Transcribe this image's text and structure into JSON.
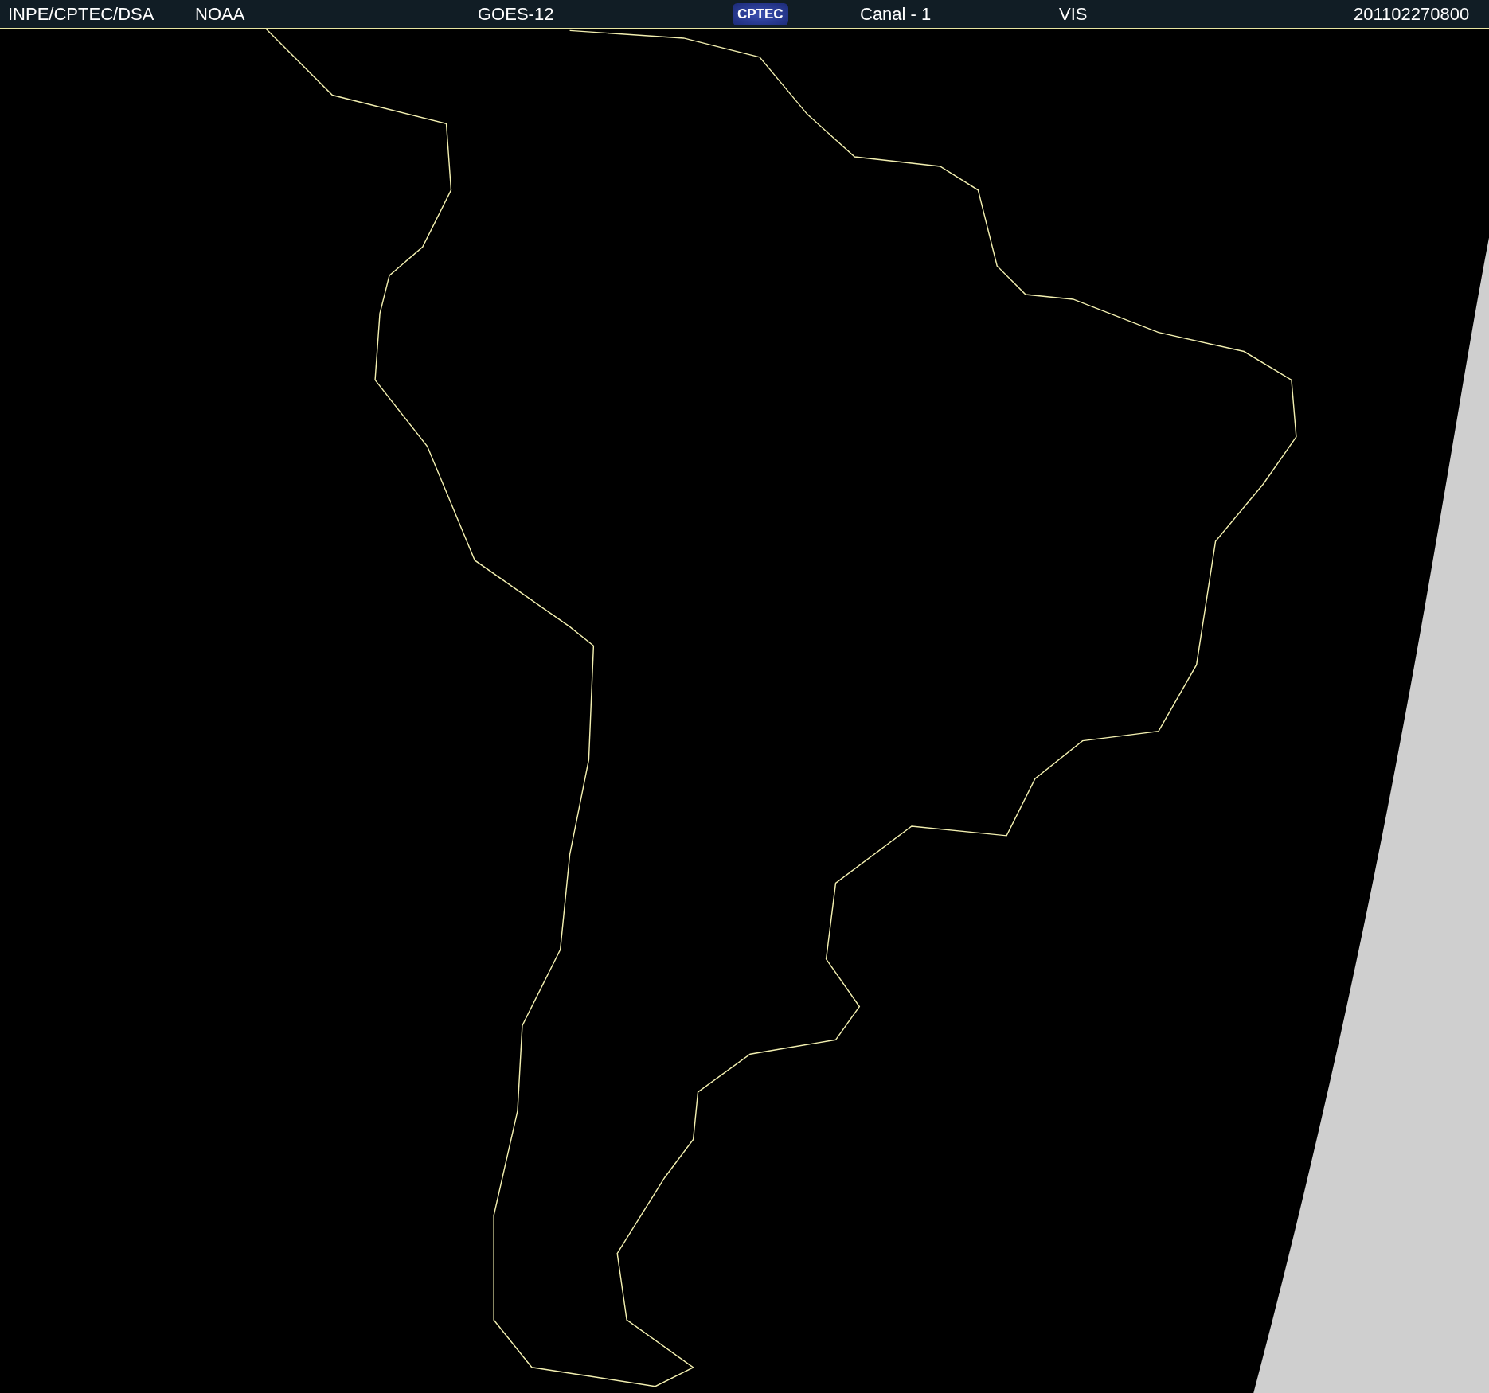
{
  "header": {
    "items": [
      {
        "kind": "text",
        "text": "INPE/CPTEC/DSA"
      },
      {
        "kind": "text",
        "text": "NOAA"
      },
      {
        "kind": "text",
        "text": "GOES-12"
      },
      {
        "kind": "logo",
        "text": "CPTEC"
      },
      {
        "kind": "text",
        "text": "Canal - 1"
      },
      {
        "kind": "text",
        "text": "VIS"
      },
      {
        "kind": "text",
        "text": "201102270800"
      }
    ]
  }
}
